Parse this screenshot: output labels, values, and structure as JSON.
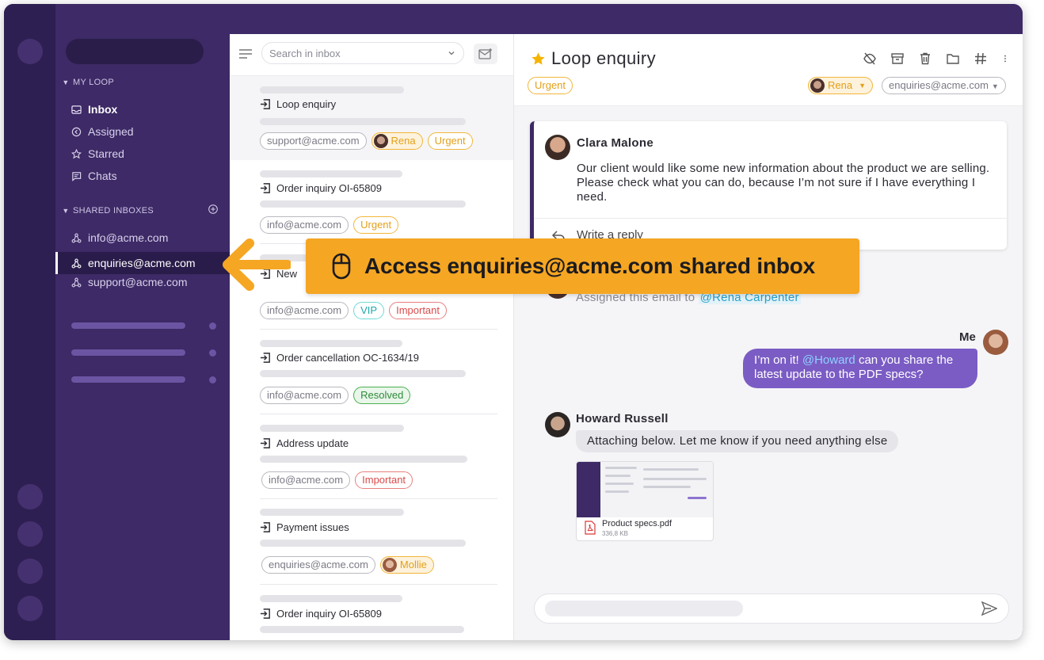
{
  "sidebar": {
    "my_loop_label": "MY LOOP",
    "my_loop_items": [
      {
        "label": "Inbox",
        "icon": "inbox-icon"
      },
      {
        "label": "Assigned",
        "icon": "assigned-icon"
      },
      {
        "label": "Starred",
        "icon": "star-icon"
      },
      {
        "label": "Chats",
        "icon": "chat-icon"
      }
    ],
    "shared_label": "SHARED INBOXES",
    "shared_items": [
      {
        "label": "info@acme.com"
      },
      {
        "label": "enquiries@acme.com",
        "active": true
      },
      {
        "label": "support@acme.com"
      }
    ]
  },
  "list": {
    "search_placeholder": "Search in inbox",
    "conversations": [
      {
        "title": "Loop enquiry",
        "tags": [
          "support@acme.com",
          "Rena",
          "Urgent"
        ]
      },
      {
        "title": "Order inquiry OI-65809",
        "tags": [
          "info@acme.com",
          "Urgent"
        ]
      },
      {
        "title": "New",
        "tags": [
          "info@acme.com",
          "VIP",
          "Important"
        ]
      },
      {
        "title": "Order cancellation OC-1634/19",
        "tags": [
          "info@acme.com",
          "Resolved"
        ]
      },
      {
        "title": "Address update",
        "tags": [
          "info@acme.com",
          "Important"
        ]
      },
      {
        "title": "Payment issues",
        "tags": [
          "enquiries@acme.com",
          "Mollie"
        ]
      },
      {
        "title": "Order inquiry OI-65809",
        "tags": []
      }
    ]
  },
  "panel": {
    "subject": "Loop enquiry",
    "status_tag": "Urgent",
    "assignee": "Rena",
    "inbox": "enquiries@acme.com",
    "email": {
      "sender": "Clara Malone",
      "body": "Our client would like some new information about the product we are selling. Please check what you can do, because I’m not sure if I have everything I need.",
      "reply_placeholder": "Write a reply"
    },
    "activity": {
      "text": "Assigned this email to ",
      "mention": "@Rena Carpenter"
    },
    "me_message": {
      "label": "Me",
      "pre": "I’m on it! ",
      "mention": "@Howard",
      "post": " can you share the latest update to the PDF specs?"
    },
    "howard_message": {
      "sender": "Howard Russell",
      "text": "Attaching below. Let me know if you need anything else",
      "attachment_name": "Product specs.pdf",
      "attachment_size": "336,8 KB"
    }
  },
  "callout": {
    "text": "Access enquiries@acme.com shared inbox",
    "color": "#f5a623"
  },
  "colors": {
    "sidebar": "#3d2a66",
    "rail": "#2e1f52",
    "accent": "#7b5cc4",
    "urgent": "#f2b63b"
  }
}
